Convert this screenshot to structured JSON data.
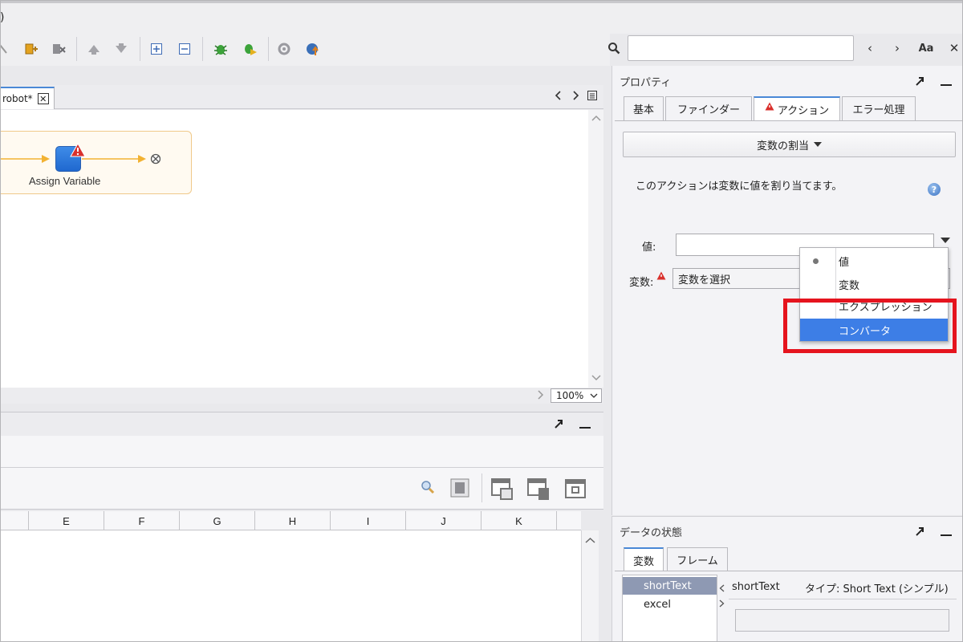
{
  "window": {
    "title_fragment": ")"
  },
  "editor": {
    "tab_label": "robot*",
    "tab_close": "✕",
    "step_label": "Assign Variable",
    "zoom": "100%"
  },
  "spreadsheet": {
    "columns": [
      "E",
      "F",
      "G",
      "H",
      "I",
      "J",
      "K"
    ]
  },
  "search": {
    "case_label": "Aa",
    "prev": "‹",
    "next": "›",
    "close": "✕"
  },
  "properties": {
    "title": "プロパティ",
    "tabs": [
      "基本",
      "ファインダー",
      "アクション",
      "エラー処理"
    ],
    "active_tab": "アクション",
    "action_dropdown": "変数の割当",
    "description": "このアクションは変数に値を割り当てます。",
    "value_label": "値:",
    "variable_label": "変数:",
    "variable_select": "変数を選択",
    "help": "?"
  },
  "value_type_menu": {
    "items": [
      "値",
      "変数",
      "エクスプレッション",
      "コンバータ"
    ],
    "selected": "コンバータ",
    "checked": "値"
  },
  "data_state": {
    "title": "データの状態",
    "tabs": [
      "変数",
      "フレーム"
    ],
    "variables": [
      "shortText",
      "excel"
    ],
    "selected_variable": "shortText",
    "detail_name": "shortText",
    "detail_type": "タイプ: Short Text (シンプル)"
  },
  "colors": {
    "accent": "#3d7ee6",
    "highlight_border": "#e5141e",
    "warning": "#d9302c"
  }
}
